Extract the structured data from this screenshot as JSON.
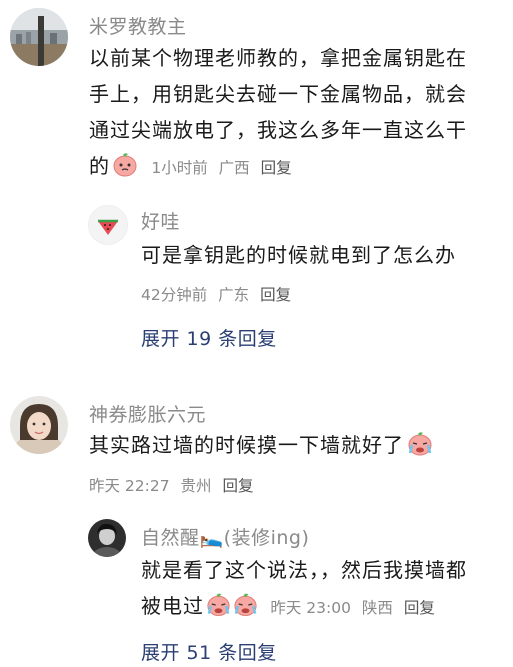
{
  "comments": [
    {
      "user": "米罗教教主",
      "lines": [
        "以前某个物理老师教的，拿把金属钥匙在",
        "手上，用钥匙尖去碰一下金属物品，就会",
        "通过尖端放电了，我这么多年一直这么干"
      ],
      "last_line": "的",
      "time": "1小时前",
      "location": "广西",
      "reply_label": "回复",
      "sub_reply": {
        "user": "好哇",
        "text": "可是拿钥匙的时候就电到了怎么办",
        "time": "42分钟前",
        "location": "广东",
        "reply_label": "回复"
      },
      "expand_label": "展开 19 条回复"
    },
    {
      "user": "神券膨胀六元",
      "text": "其实路过墙的时候摸一下墙就好了",
      "time": "昨天 22:27",
      "location": "贵州",
      "reply_label": "回复",
      "sub_reply": {
        "user": "自然醒🛌(装修ing)",
        "line1": "就是看了这个说法，，然后我摸墙都",
        "line2": "被电过",
        "time": "昨天 23:00",
        "location": "陕西",
        "reply_label": "回复"
      },
      "expand_label": "展开 51 条回复"
    }
  ],
  "icons": {
    "peach_emoji": "peach-face-emoji",
    "crying_emoji": "crying-face-emoji",
    "watermelon": "watermelon-avatar"
  },
  "colors": {
    "link": "#2b3f73",
    "muted": "#8a8a8a",
    "emoji_pink": "#f5a1a0"
  }
}
